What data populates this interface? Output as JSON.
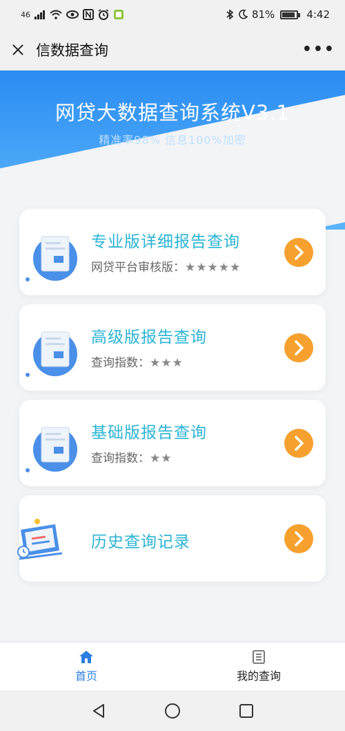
{
  "status_bar": {
    "network": "46",
    "battery_text": "81%",
    "battery_level": 0.81,
    "time": "4:42"
  },
  "header": {
    "title": "信数据查询",
    "more": "•••"
  },
  "banner": {
    "title": "网贷大数据查询系统V3.1",
    "subtitle": "精准率98% 信息100%加密"
  },
  "cards": [
    {
      "title": "专业版详细报告查询",
      "sub_label": "网贷平台审核版：",
      "stars": "★★★★★"
    },
    {
      "title": "高级版报告查询",
      "sub_label": "查询指数：",
      "stars": "★★★"
    },
    {
      "title": "基础版报告查询",
      "sub_label": "查询指数：",
      "stars": "★★"
    },
    {
      "title": "历史查询记录",
      "sub_label": "",
      "stars": ""
    }
  ],
  "bottom_nav": {
    "home_label": "首页",
    "my_queries_label": "我的查询"
  },
  "colors": {
    "accent": "#2b7fe0",
    "card_title": "#2bb4d4",
    "arrow": "#f6a12e"
  }
}
